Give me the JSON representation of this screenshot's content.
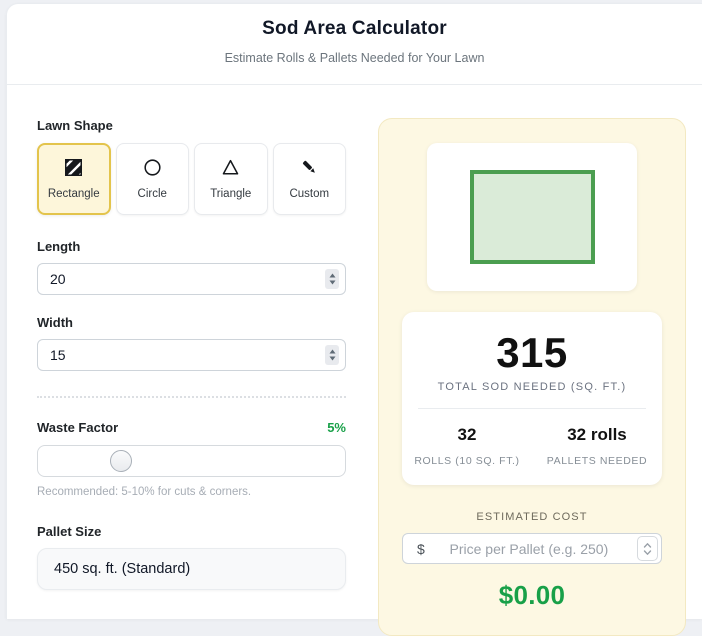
{
  "header": {
    "title": "Sod Area Calculator",
    "subtitle": "Estimate Rolls & Pallets Needed for Your Lawn"
  },
  "form": {
    "shape_group_label": "Lawn Shape",
    "shapes": [
      {
        "label": "Rectangle",
        "icon": "hatched-square-icon",
        "selected": true
      },
      {
        "label": "Circle",
        "icon": "circle-icon",
        "selected": false
      },
      {
        "label": "Triangle",
        "icon": "triangle-icon",
        "selected": false
      },
      {
        "label": "Custom",
        "icon": "pencil-icon",
        "selected": false
      }
    ],
    "length": {
      "label": "Length",
      "value": "20"
    },
    "width": {
      "label": "Width",
      "value": "15"
    },
    "waste": {
      "label": "Waste Factor",
      "value": "5%",
      "hint": "Recommended: 5-10% for cuts & corners."
    },
    "pallet": {
      "label": "Pallet Size",
      "value": "450 sq. ft. (Standard)"
    }
  },
  "results": {
    "total_value": "315",
    "total_label": "TOTAL SOD NEEDED (SQ. FT.)",
    "stats": [
      {
        "value": "32",
        "label": "ROLLS (10 SQ. FT.)"
      },
      {
        "value": "32 rolls",
        "label": "PALLETS NEEDED"
      }
    ],
    "cost_label": "ESTIMATED COST",
    "currency_symbol": "$",
    "price_placeholder": "Price per Pallet (e.g. 250)",
    "estimated_cost": "$0.00"
  },
  "colors": {
    "accent_green": "#18a048",
    "selected_yellow_border": "#e3c44c",
    "panel_background": "#fdf8e3",
    "shape_fill_green": "#daebd8",
    "shape_border_green": "#4b9e50"
  }
}
